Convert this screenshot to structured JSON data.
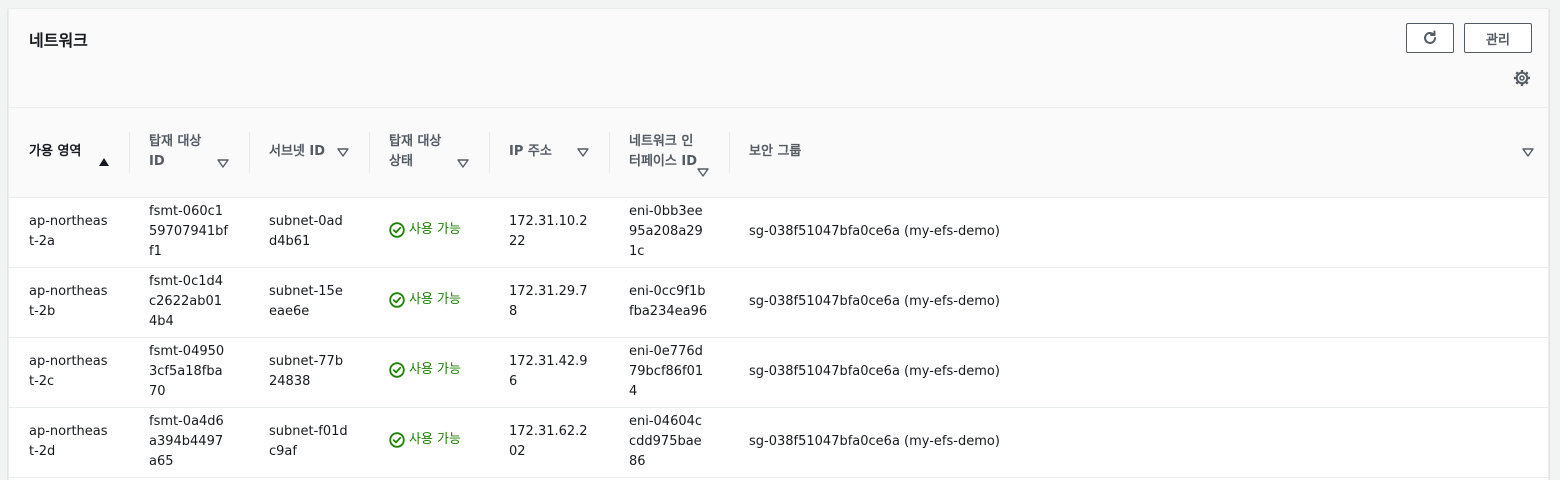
{
  "section": {
    "title": "네트워크",
    "manage_label": "관리"
  },
  "icons": {
    "refresh": "refresh-icon",
    "settings": "gear-icon",
    "status_ok": "check-circle-icon",
    "sort_desc": "caret-up-icon",
    "sort_none": "caret-down-icon"
  },
  "colors": {
    "status_ok": "#1d8102",
    "header_text": "#545b64",
    "border": "#eaeded"
  },
  "table": {
    "columns": [
      {
        "label": "가용 영역"
      },
      {
        "label": "탑재 대상 ID"
      },
      {
        "label": "서브넷 ID"
      },
      {
        "label": "탑재 대상 상태"
      },
      {
        "label": "IP 주소"
      },
      {
        "label": "네트워크 인터페이스 ID"
      },
      {
        "label": "보안 그룹"
      }
    ],
    "rows": [
      {
        "az": "ap-northeast-2a",
        "mount_target": "fsmt-060c159707941bff1",
        "subnet": "subnet-0add4b61",
        "status": "사용 가능",
        "ip": "172.31.10.222",
        "eni": "eni-0bb3ee95a208a291c",
        "sg": "sg-038f51047bfa0ce6a (my-efs-demo)"
      },
      {
        "az": "ap-northeast-2b",
        "mount_target": "fsmt-0c1d4c2622ab014b4",
        "subnet": "subnet-15eeae6e",
        "status": "사용 가능",
        "ip": "172.31.29.78",
        "eni": "eni-0cc9f1bfba234ea96",
        "sg": "sg-038f51047bfa0ce6a (my-efs-demo)"
      },
      {
        "az": "ap-northeast-2c",
        "mount_target": "fsmt-049503cf5a18fba70",
        "subnet": "subnet-77b24838",
        "status": "사용 가능",
        "ip": "172.31.42.96",
        "eni": "eni-0e776d79bcf86f014",
        "sg": "sg-038f51047bfa0ce6a (my-efs-demo)"
      },
      {
        "az": "ap-northeast-2d",
        "mount_target": "fsmt-0a4d6a394b4497a65",
        "subnet": "subnet-f01dc9af",
        "status": "사용 가능",
        "ip": "172.31.62.202",
        "eni": "eni-04604ccdd975bae86",
        "sg": "sg-038f51047bfa0ce6a (my-efs-demo)"
      }
    ]
  }
}
